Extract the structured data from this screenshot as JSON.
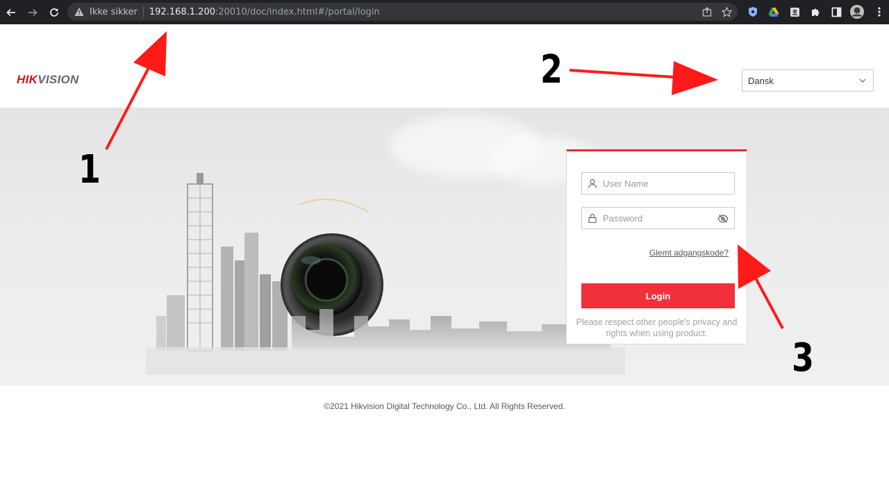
{
  "browser": {
    "security_label": "Ikke sikker",
    "url_host": "192.168.1.200",
    "url_path": ":20010/doc/index.html#/portal/login"
  },
  "header": {
    "logo_part1": "HIK",
    "logo_part2": "VISION",
    "language_selected": "Dansk"
  },
  "login": {
    "username_placeholder": "User Name",
    "password_placeholder": "Password",
    "forgot_label": "Glemt adgangskode?",
    "login_label": "Login",
    "privacy_note": "Please respect other people's privacy and rights when using product."
  },
  "footer": {
    "copyright": "©2021 Hikvision Digital Technology Co., Ltd. All Rights Reserved."
  },
  "annotations": {
    "one": "1",
    "two": "2",
    "three": "3",
    "arrow_color": "#ff1a1a"
  },
  "colors": {
    "brand_red": "#d7141e",
    "button_red": "#f0303a"
  }
}
